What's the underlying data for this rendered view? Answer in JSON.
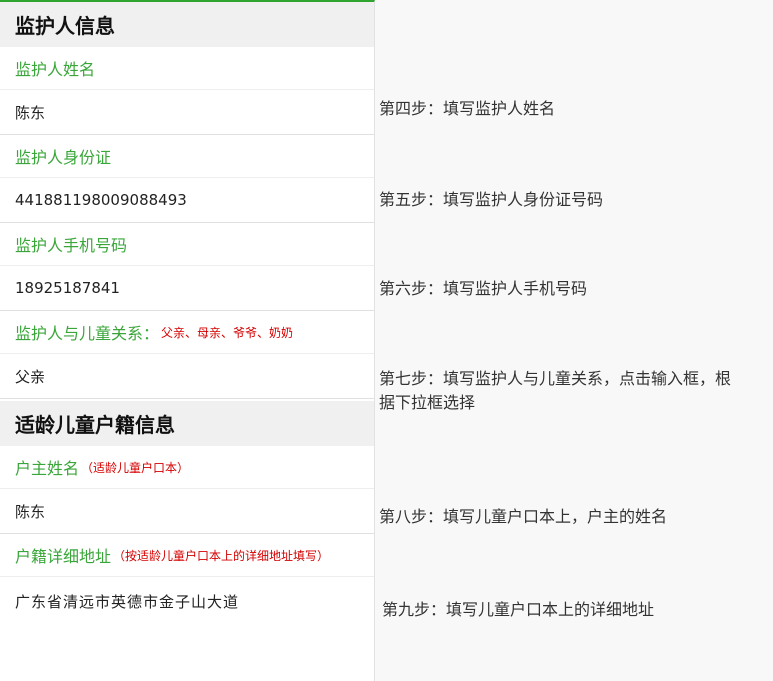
{
  "guardian_section": {
    "title": "监护人信息",
    "fields": [
      {
        "label": "监护人姓名",
        "hint": "",
        "value": "陈东"
      },
      {
        "label": "监护人身份证",
        "hint": "",
        "value": "441881198009088493"
      },
      {
        "label": "监护人手机号码",
        "hint": "",
        "value": "18925187841"
      },
      {
        "label": "监护人与儿童关系：",
        "hint": "父亲、母亲、爷爷、奶奶",
        "value": "父亲"
      }
    ]
  },
  "household_section": {
    "title": "适龄儿童户籍信息",
    "fields": [
      {
        "label": "户主姓名",
        "hint": "（适龄儿童户口本）",
        "value": "陈东"
      },
      {
        "label": "户籍详细地址",
        "hint": "（按适龄儿童户口本上的详细地址填写）",
        "value": "广东省清远市英德市金子山大道"
      }
    ]
  },
  "steps": [
    "第四步：填写监护人姓名",
    "第五步：填写监护人身份证号码",
    "第六步：填写监护人手机号码",
    "第七步：填写监护人与儿童关系，点击输入框，根据下拉框选择",
    "第八步：填写儿童户口本上，户主的姓名",
    "第九步：填写儿童户口本上的详细地址"
  ],
  "colors": {
    "label_green": "#3aa63a",
    "hint_red": "#d40000",
    "top_border_green": "#2fa52f"
  }
}
